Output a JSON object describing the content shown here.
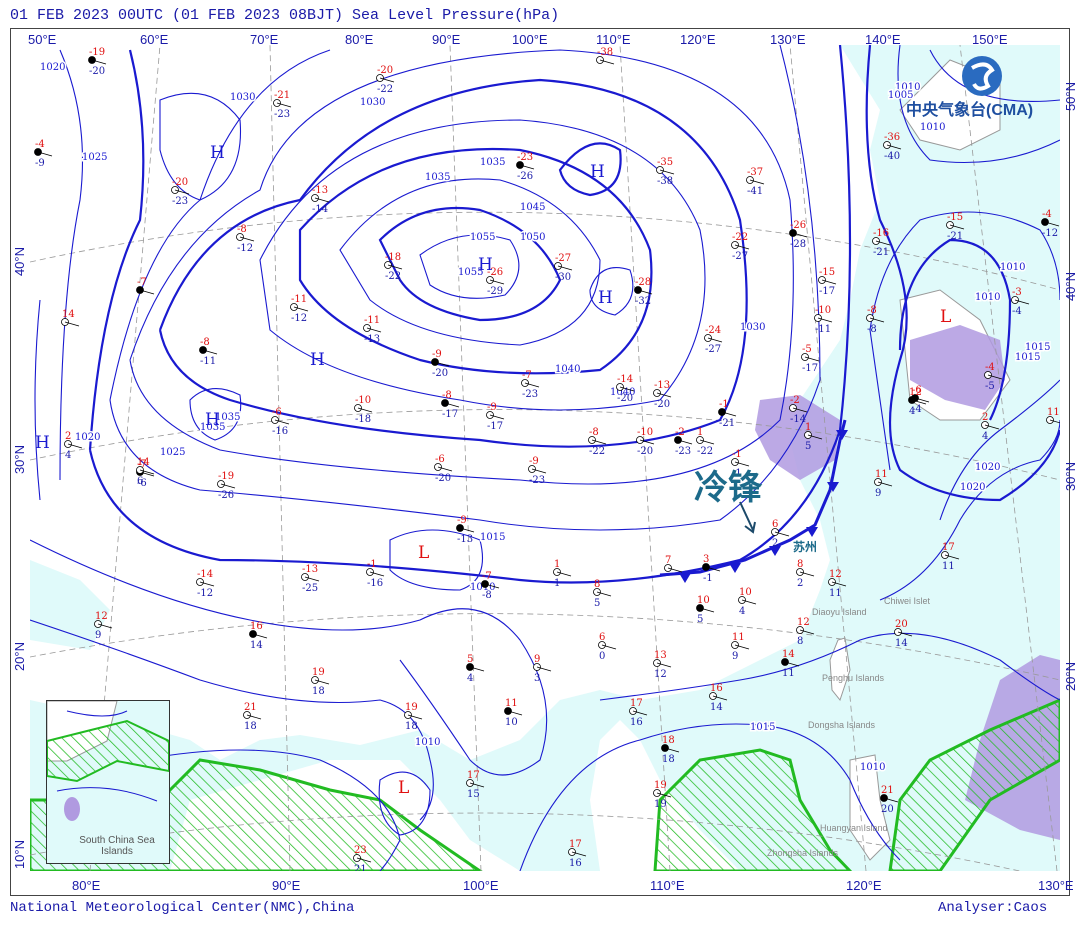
{
  "title": "01 FEB 2023 00UTC  (01 FEB 2023 08BJT) Sea Level Pressure(hPa)",
  "top_lon_labels": [
    "50°E",
    "60°E",
    "70°E",
    "80°E",
    "90°E",
    "100°E",
    "110°E",
    "120°E",
    "130°E",
    "140°E",
    "150°E"
  ],
  "bottom_lon_labels": [
    "80°E",
    "90°E",
    "100°E",
    "110°E",
    "120°E",
    "130°E"
  ],
  "left_lat_labels": [
    "40°N",
    "30°N",
    "20°N",
    "10°N"
  ],
  "right_lat_labels": [
    "50°N",
    "40°N",
    "30°N",
    "20°N"
  ],
  "logo": {
    "text": "中央气象台(CMA)"
  },
  "footer": {
    "left": "National Meteorological Center(NMC),China",
    "right": "Analyser:Caos"
  },
  "annotations": {
    "cold_front": "冷锋",
    "city": "苏州"
  },
  "inset_label": "South China Sea Islands",
  "islands": [
    "Chiwei Islet",
    "Diaoyu Island",
    "Penghu Islands",
    "Dongsha Islands",
    "Huangyan Island",
    "Zhongsha Islands"
  ],
  "pressure_centers": [
    "H",
    "H",
    "H",
    "H",
    "H",
    "H",
    "H",
    "L",
    "L",
    "L"
  ],
  "isobar_labels": [
    "1020",
    "1025",
    "1030",
    "1030",
    "1035",
    "1040",
    "1045",
    "1050",
    "1055",
    "1055",
    "1040",
    "1035",
    "1030",
    "1035",
    "1035",
    "1025",
    "1020",
    "1010",
    "1015",
    "1010",
    "1010",
    "1010",
    "1005",
    "1010",
    "1015",
    "1020",
    "1020",
    "1015",
    "1010",
    "1010",
    "1015"
  ],
  "colors": {
    "isobar": "#1a1ad0",
    "temperature": "#e01010",
    "dewpoint": "#1a1aa8",
    "sea": "#e0fafa",
    "land": "#ffffff",
    "precip_hatch": "#22bb22",
    "fog_area": "#b09ae0",
    "border": "#999999",
    "front": "#1a1ad0"
  },
  "stations": [
    {
      "t": "-19",
      "d": "-20"
    },
    {
      "t": "-20",
      "d": "-22"
    },
    {
      "t": "-21",
      "d": "-23"
    },
    {
      "t": "-38",
      "d": ""
    },
    {
      "t": "-4",
      "d": "-9"
    },
    {
      "t": "-20",
      "d": "-23"
    },
    {
      "t": "-13",
      "d": "-14"
    },
    {
      "t": "-8",
      "d": "-12"
    },
    {
      "t": "-23",
      "d": "-26"
    },
    {
      "t": "-35",
      "d": "-38"
    },
    {
      "t": "-37",
      "d": "-41"
    },
    {
      "t": "-36",
      "d": "-40"
    },
    {
      "t": "-26",
      "d": "-28"
    },
    {
      "t": "-22",
      "d": "-27"
    },
    {
      "t": "-16",
      "d": "-21"
    },
    {
      "t": "-15",
      "d": "-21"
    },
    {
      "t": "-4",
      "d": "-12"
    },
    {
      "t": "-18",
      "d": "-22"
    },
    {
      "t": "-26",
      "d": "-29"
    },
    {
      "t": "-27",
      "d": "-30"
    },
    {
      "t": "-28",
      "d": "-32"
    },
    {
      "t": "-15",
      "d": "-17"
    },
    {
      "t": "-10",
      "d": "-11"
    },
    {
      "t": "-8",
      "d": "-8"
    },
    {
      "t": "-7",
      "d": ""
    },
    {
      "t": "14",
      "d": ""
    },
    {
      "t": "-11",
      "d": "-12"
    },
    {
      "t": "-11",
      "d": "-13"
    },
    {
      "t": "-8",
      "d": "-11"
    },
    {
      "t": "-24",
      "d": "-27"
    },
    {
      "t": "-5",
      "d": "-17"
    },
    {
      "t": "-3",
      "d": "-4"
    },
    {
      "t": "-9",
      "d": "-20"
    },
    {
      "t": "-7",
      "d": "-23"
    },
    {
      "t": "-14",
      "d": "-20"
    },
    {
      "t": "-13",
      "d": "-20"
    },
    {
      "t": "-6",
      "d": "-4"
    },
    {
      "t": "-4",
      "d": "-5"
    },
    {
      "t": "-6",
      "d": "-16"
    },
    {
      "t": "-10",
      "d": "-18"
    },
    {
      "t": "-8",
      "d": "-17"
    },
    {
      "t": "-9",
      "d": "-17"
    },
    {
      "t": "-8",
      "d": "-22"
    },
    {
      "t": "-10",
      "d": "-20"
    },
    {
      "t": "-1",
      "d": "-21"
    },
    {
      "t": "-2",
      "d": "-14"
    },
    {
      "t": "1",
      "d": "5"
    },
    {
      "t": "2",
      "d": "4"
    },
    {
      "t": "-7",
      "d": "-6"
    },
    {
      "t": "-19",
      "d": "-26"
    },
    {
      "t": "-6",
      "d": "-20"
    },
    {
      "t": "-9",
      "d": "-23"
    },
    {
      "t": "-2",
      "d": "-23"
    },
    {
      "t": "1",
      "d": "-22"
    },
    {
      "t": "-1",
      "d": "-1"
    },
    {
      "t": "11",
      "d": "9"
    },
    {
      "t": "-9",
      "d": "-13"
    },
    {
      "t": "-1",
      "d": "-16"
    },
    {
      "t": "-14",
      "d": "-12"
    },
    {
      "t": "-13",
      "d": "-25"
    },
    {
      "t": "-7",
      "d": "-8"
    },
    {
      "t": "1",
      "d": "1"
    },
    {
      "t": "8",
      "d": "5"
    },
    {
      "t": "7",
      "d": ""
    },
    {
      "t": "3",
      "d": "-1"
    },
    {
      "t": "6",
      "d": "2"
    },
    {
      "t": "8",
      "d": "2"
    },
    {
      "t": "12",
      "d": "11"
    },
    {
      "t": "10",
      "d": "5"
    },
    {
      "t": "10",
      "d": "4"
    },
    {
      "t": "11",
      "d": "9"
    },
    {
      "t": "12",
      "d": "8"
    },
    {
      "t": "14",
      "d": "11"
    },
    {
      "t": "17",
      "d": "11"
    },
    {
      "t": "20",
      "d": "14"
    },
    {
      "t": "12",
      "d": "9"
    },
    {
      "t": "16",
      "d": "14"
    },
    {
      "t": "19",
      "d": "18"
    },
    {
      "t": "21",
      "d": "18"
    },
    {
      "t": "19",
      "d": "18"
    },
    {
      "t": "5",
      "d": "4"
    },
    {
      "t": "9",
      "d": "3"
    },
    {
      "t": "6",
      "d": "0"
    },
    {
      "t": "13",
      "d": "12"
    },
    {
      "t": "11",
      "d": "10"
    },
    {
      "t": "17",
      "d": "15"
    },
    {
      "t": "17",
      "d": "16"
    },
    {
      "t": "16",
      "d": "14"
    },
    {
      "t": "18",
      "d": "18"
    },
    {
      "t": "19",
      "d": "19"
    },
    {
      "t": "17",
      "d": "16"
    },
    {
      "t": "23",
      "d": "21"
    },
    {
      "t": "21",
      "d": "20"
    },
    {
      "t": "11",
      "d": ""
    },
    {
      "t": "2",
      "d": "4"
    },
    {
      "t": "14",
      "d": "6"
    },
    {
      "t": "12",
      "d": "4"
    }
  ]
}
